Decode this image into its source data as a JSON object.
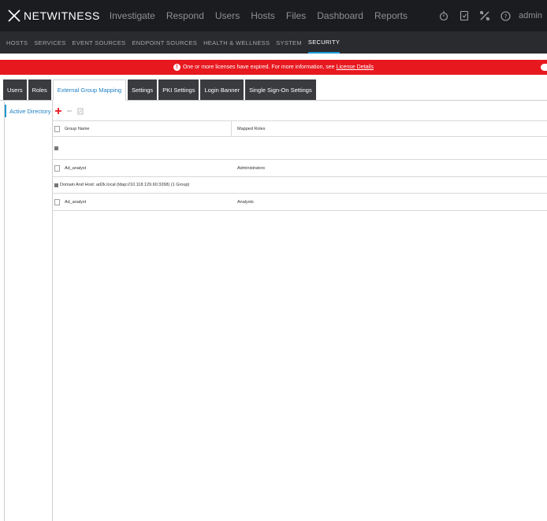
{
  "app": {
    "logo_text": "NETWITNESS",
    "nav": [
      "Investigate",
      "Respond",
      "Users",
      "Hosts",
      "Files",
      "Dashboard",
      "Reports"
    ],
    "user": "admin"
  },
  "subnav": {
    "items": [
      "HOSTS",
      "SERVICES",
      "EVENT SOURCES",
      "ENDPOINT SOURCES",
      "HEALTH & WELLNESS",
      "SYSTEM",
      "SECURITY"
    ],
    "active": "SECURITY"
  },
  "banner": {
    "message": "One or more licenses have expired. For more information, see",
    "link": "License Details",
    "color": "#e8181f"
  },
  "tabs": {
    "items": [
      "Users",
      "Roles",
      "External Group Mapping",
      "Settings",
      "PKI Settings",
      "Login Banner",
      "Single Sign-On Settings"
    ],
    "active": "External Group Mapping"
  },
  "sidebar": {
    "items": [
      "Active Directory"
    ]
  },
  "toolbar": {
    "icons": [
      "add-icon",
      "remove-icon",
      "edit-icon"
    ]
  },
  "grid": {
    "columns": [
      "Group Name",
      "Mapped Roles"
    ],
    "groups": [
      {
        "label": "",
        "rows": [
          {
            "name": "Ad_analyst",
            "roles": "Administrators"
          }
        ]
      },
      {
        "label": "Domain And Host: ad2k.local (ldap://10.118.129.60:3268) (1 Group)",
        "rows": [
          {
            "name": "Ad_analyst",
            "roles": "Analysts"
          }
        ]
      }
    ]
  },
  "colors": {
    "accent": "#1c9ad6",
    "topbar": "#1b1c1f",
    "add_icon": "#e8181f"
  }
}
